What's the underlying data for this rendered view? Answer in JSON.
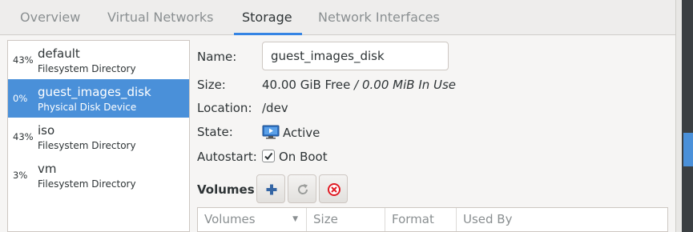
{
  "tabs": [
    {
      "label": "Overview"
    },
    {
      "label": "Virtual Networks"
    },
    {
      "label": "Storage"
    },
    {
      "label": "Network Interfaces"
    }
  ],
  "active_tab": "Storage",
  "pools": [
    {
      "percent": "43%",
      "name": "default",
      "type": "Filesystem Directory"
    },
    {
      "percent": "0%",
      "name": "guest_images_disk",
      "type": "Physical Disk Device"
    },
    {
      "percent": "43%",
      "name": "iso",
      "type": "Filesystem Directory"
    },
    {
      "percent": "3%",
      "name": "vm",
      "type": "Filesystem Directory"
    }
  ],
  "selected_pool": "guest_images_disk",
  "details": {
    "name_label": "Name:",
    "name_value": "guest_images_disk",
    "size_label": "Size:",
    "size_free": "40.00 GiB Free",
    "size_separator": " / ",
    "size_used": "0.00 MiB In Use",
    "location_label": "Location:",
    "location_value": "/dev",
    "state_label": "State:",
    "state_value": "Active",
    "state_icon": "monitor-play-icon",
    "autostart_label": "Autostart:",
    "autostart_value": "On Boot",
    "autostart_checked": true
  },
  "volumes": {
    "label": "Volumes",
    "buttons": [
      {
        "icon": "add-icon"
      },
      {
        "icon": "refresh-icon"
      },
      {
        "icon": "delete-icon"
      }
    ],
    "columns": [
      "Volumes",
      "Size",
      "Format",
      "Used By"
    ],
    "sorted_column": "Volumes"
  },
  "colors": {
    "selection": "#4a90d9",
    "active_tab_underline": "#3584e4",
    "delete": "#e01b24"
  }
}
